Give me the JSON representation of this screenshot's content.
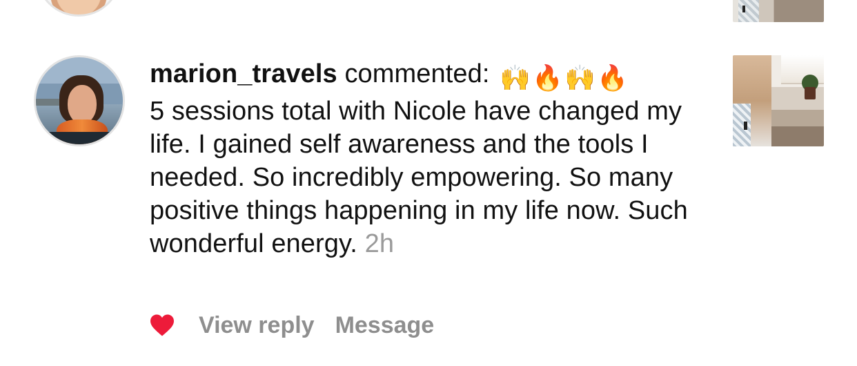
{
  "comment": {
    "username": "marion_travels",
    "action": "commented:",
    "emojis": [
      "🙌",
      "🔥",
      "🙌",
      "🔥"
    ],
    "text": "5 sessions total with Nicole have changed my life. I gained self awareness and the tools I needed. So incredibly empowering. So many positive things happening in my life now. Such wonderful energy.",
    "time": "2h",
    "liked": true
  },
  "actions": {
    "view_reply": "View reply",
    "message": "Message"
  },
  "colors": {
    "heart": "#ed1b3a",
    "secondary_text": "#8e8e8e",
    "timestamp": "#9a9a9a"
  }
}
